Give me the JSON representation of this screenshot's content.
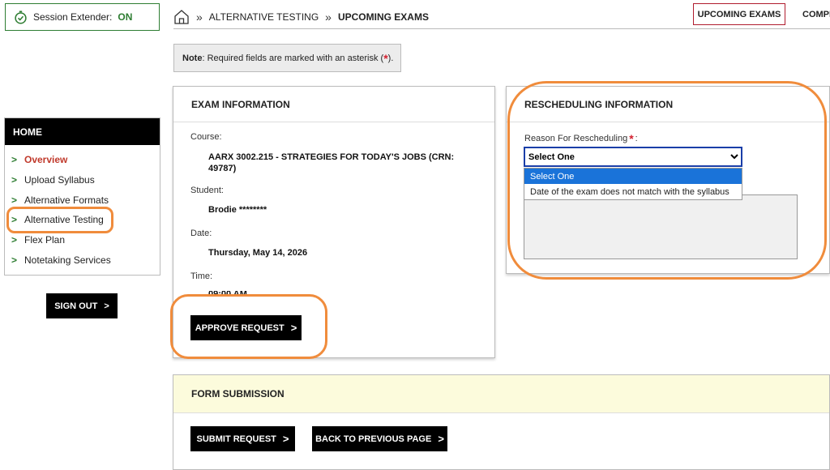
{
  "session": {
    "label": "Session Extender:",
    "status": "ON"
  },
  "breadcrumb": {
    "section": "ALTERNATIVE TESTING",
    "current": "UPCOMING EXAMS",
    "separator": "»"
  },
  "top_tabs": {
    "upcoming": "UPCOMING EXAMS",
    "completed": "COMPI"
  },
  "note": {
    "bold": "Note",
    "text": ": Required fields are marked with an asterisk (",
    "star": "*",
    "end": ")."
  },
  "sidebar": {
    "heading": "HOME",
    "items": [
      {
        "label": "Overview"
      },
      {
        "label": "Upload Syllabus"
      },
      {
        "label": "Alternative Formats"
      },
      {
        "label": "Alternative Testing"
      },
      {
        "label": "Flex Plan"
      },
      {
        "label": "Notetaking Services"
      }
    ],
    "signout": "SIGN OUT"
  },
  "exam": {
    "title": "EXAM INFORMATION",
    "course_label": "Course:",
    "course_value": "AARX 3002.215 - STRATEGIES FOR TODAY'S JOBS (CRN: 49787)",
    "student_label": "Student:",
    "student_value": "Brodie ********",
    "date_label": "Date:",
    "date_value": "Thursday, May 14, 2026",
    "time_label": "Time:",
    "time_value": "09:00 AM",
    "approve_button": "APPROVE REQUEST"
  },
  "reschedule": {
    "title": "RESCHEDULING INFORMATION",
    "reason_label": "Reason For Rescheduling",
    "reason_star": "*",
    "reason_colon": ":",
    "selected": "Select One",
    "options": [
      "Select One",
      "Date of the exam does not match with the syllabus"
    ]
  },
  "submission": {
    "title": "FORM SUBMISSION",
    "submit_button": "SUBMIT REQUEST",
    "back_button": "BACK TO PREVIOUS PAGE"
  },
  "colors": {
    "accent_green": "#2e7d32",
    "accent_red": "#b01c2e",
    "annotation_orange": "#f08c3c",
    "select_blue": "#1a73d9"
  },
  "icons": {
    "timer": "stopwatch-check-icon",
    "home": "home-icon",
    "chevron": "chevron-right-icon"
  }
}
